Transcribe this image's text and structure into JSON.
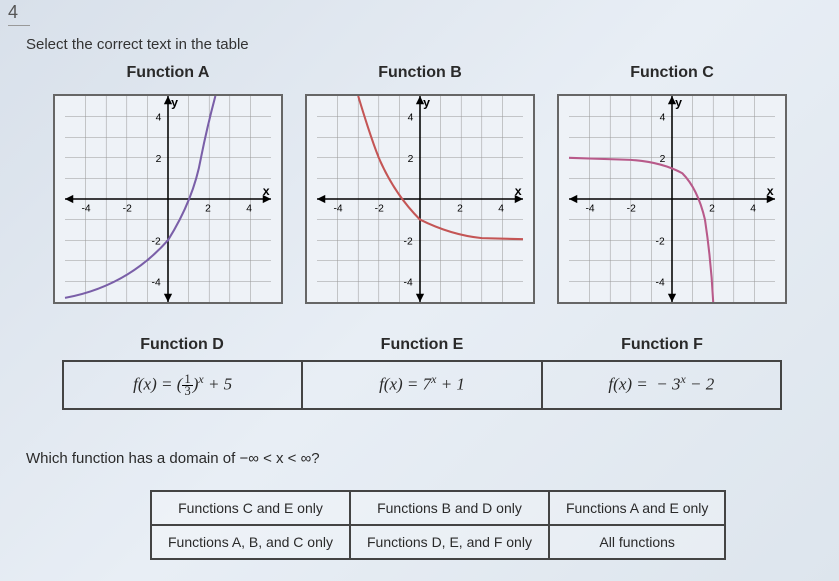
{
  "question_number": "4",
  "prompt": "Select the correct text in the table",
  "graphs": {
    "a": {
      "title": "Function A",
      "ylabel": "y",
      "xlabel": "x",
      "ticks_x": [
        "-4",
        "-2",
        "2",
        "4"
      ],
      "ticks_y": [
        "4",
        "2",
        "-2",
        "-4"
      ]
    },
    "b": {
      "title": "Function B",
      "ylabel": "y",
      "xlabel": "x",
      "ticks_x": [
        "-4",
        "-2",
        "2",
        "4"
      ],
      "ticks_y": [
        "4",
        "2",
        "-2",
        "-4"
      ]
    },
    "c": {
      "title": "Function C",
      "ylabel": "y",
      "xlabel": "x",
      "ticks_x": [
        "-4",
        "-2",
        "2",
        "4"
      ],
      "ticks_y": [
        "4",
        "2",
        "-2",
        "-4"
      ]
    }
  },
  "functions_row": {
    "d": {
      "title": "Function D",
      "formula_html": "f(x) = (⅓)ˣ + 5"
    },
    "e": {
      "title": "Function E",
      "formula_html": "f(x) = 7ˣ + 1"
    },
    "f": {
      "title": "Function F",
      "formula_html": "f(x) = − 3ˣ − 2"
    }
  },
  "question2": "Which function has a domain of −∞ < x < ∞?",
  "answers": [
    [
      "Functions C and E only",
      "Functions B and D only",
      "Functions A and E only"
    ],
    [
      "Functions A, B, and C only",
      "Functions D, E, and F only",
      "All functions"
    ]
  ],
  "chart_data": [
    {
      "type": "line",
      "title": "Function A",
      "xlabel": "x",
      "ylabel": "y",
      "xlim": [
        -5,
        5
      ],
      "ylim": [
        -5,
        5
      ],
      "series": [
        {
          "name": "curve",
          "x": [
            -5,
            -4,
            -3,
            -2,
            -1,
            0,
            1,
            1.6,
            2,
            2.3
          ],
          "y": [
            -4.8,
            -4.5,
            -4.2,
            -3.8,
            -3.2,
            -2,
            0,
            2,
            3.5,
            5
          ]
        }
      ]
    },
    {
      "type": "line",
      "title": "Function B",
      "xlabel": "x",
      "ylabel": "y",
      "xlim": [
        -5,
        5
      ],
      "ylim": [
        -5,
        5
      ],
      "series": [
        {
          "name": "curve",
          "x": [
            -3,
            -2.5,
            -2,
            -1,
            0,
            1,
            2,
            3,
            4,
            5
          ],
          "y": [
            5,
            3.5,
            2,
            0,
            -1,
            -1.5,
            -1.8,
            -1.9,
            -1.95,
            -2
          ]
        }
      ]
    },
    {
      "type": "line",
      "title": "Function C",
      "xlabel": "x",
      "ylabel": "y",
      "xlim": [
        -5,
        5
      ],
      "ylim": [
        -5,
        5
      ],
      "series": [
        {
          "name": "curve",
          "x": [
            -5,
            -3,
            -1,
            0,
            0.8,
            1.3,
            1.7,
            2
          ],
          "y": [
            2,
            1.95,
            1.8,
            1.5,
            0.5,
            -1,
            -3,
            -5
          ]
        }
      ]
    }
  ]
}
